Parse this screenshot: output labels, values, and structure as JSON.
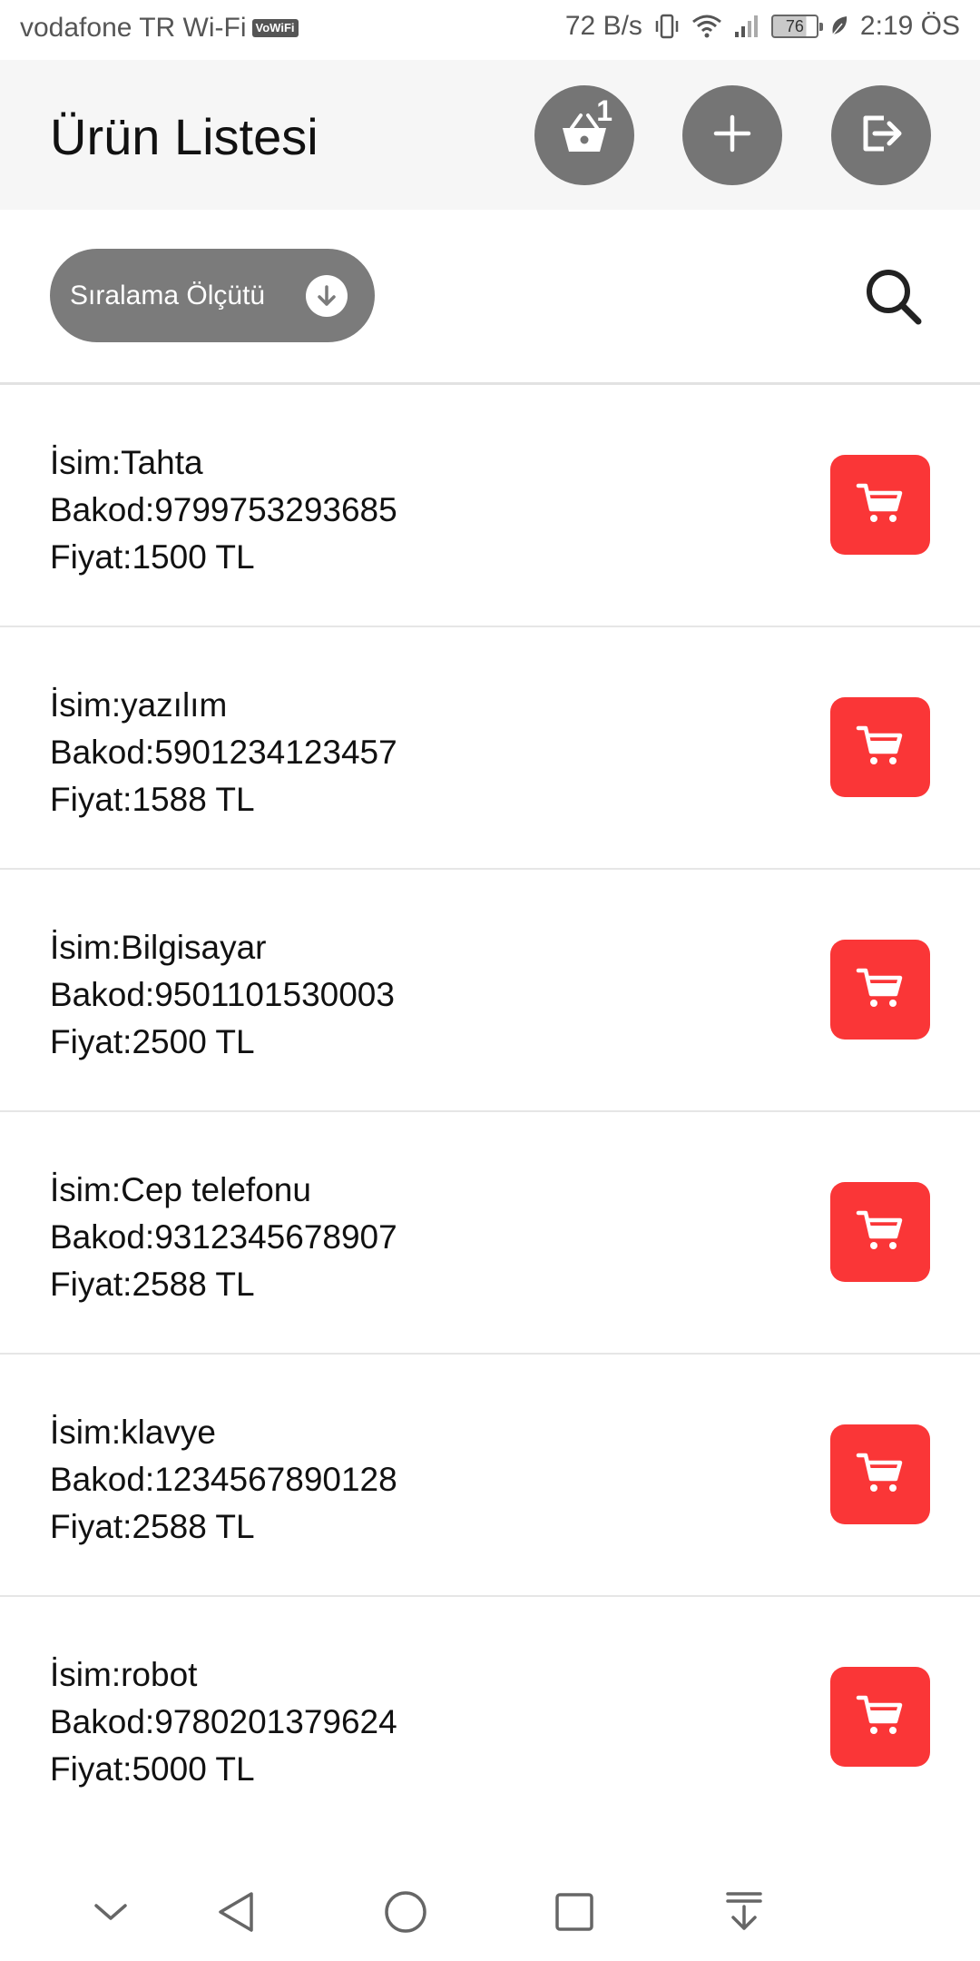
{
  "status_bar": {
    "carrier": "vodafone TR Wi-Fi",
    "vowifi": "VoWiFi",
    "speed": "72 B/s",
    "battery": "76",
    "time": "2:19 ÖS"
  },
  "header": {
    "title": "Ürün Listesi",
    "basket_count": "1"
  },
  "toolbar": {
    "sort_label": "Sıralama Ölçütü"
  },
  "products": [
    {
      "name": "İsim:Tahta",
      "barcode": "Bakod:9799753293685",
      "price": "Fiyat:1500 TL"
    },
    {
      "name": "İsim:yazılım",
      "barcode": "Bakod:5901234123457",
      "price": "Fiyat:1588 TL"
    },
    {
      "name": "İsim:Bilgisayar",
      "barcode": "Bakod:9501101530003",
      "price": "Fiyat:2500 TL"
    },
    {
      "name": "İsim:Cep telefonu",
      "barcode": "Bakod:9312345678907",
      "price": "Fiyat:2588 TL"
    },
    {
      "name": "İsim:klavye",
      "barcode": "Bakod:1234567890128",
      "price": "Fiyat:2588 TL"
    },
    {
      "name": "İsim:robot",
      "barcode": "Bakod:9780201379624",
      "price": "Fiyat:5000 TL"
    }
  ],
  "icons": {
    "basket": "basket-icon",
    "add": "plus-icon",
    "logout": "logout-icon",
    "sort": "arrow-down-circle-icon",
    "search": "search-icon",
    "cart": "cart-icon"
  },
  "colors": {
    "header_bg": "#f6f6f6",
    "round_button": "#757575",
    "sort_button": "#7b7b7b",
    "cart_button": "#fa3637"
  }
}
